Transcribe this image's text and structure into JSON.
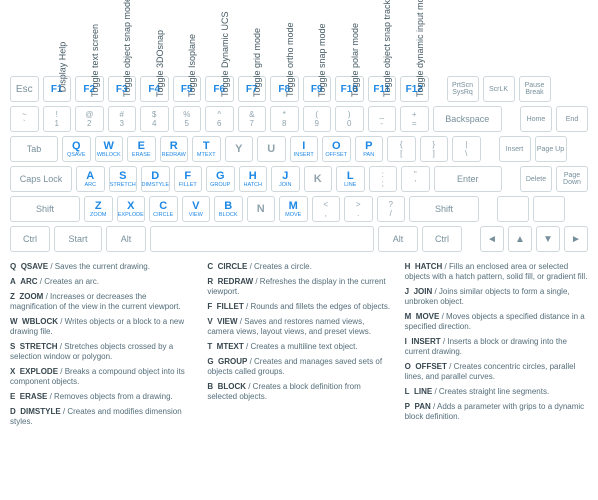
{
  "function_labels": [
    "Display Help",
    "Toggle text screen",
    "Toggle object snap mode",
    "Toggle 3DOsnap",
    "Toggle Isoplane",
    "Toggle Dynamic UCS",
    "Toggle grid mode",
    "Toggle ortho mode",
    "Toggle snap mode",
    "Toggle polar mode",
    "Toggle object snap tracking",
    "Toggle dynamic input mode"
  ],
  "fkeys": [
    "Esc",
    "F1",
    "F2",
    "F3",
    "F4",
    "F5",
    "F6",
    "F7",
    "F8",
    "F9",
    "F10",
    "F11",
    "F12"
  ],
  "side_top": [
    "PrtScn SysRq",
    "ScrLK",
    "Pause Break"
  ],
  "num_row": [
    [
      "~",
      "`"
    ],
    [
      "!",
      "1"
    ],
    [
      "@",
      "2"
    ],
    [
      "#",
      "3"
    ],
    [
      "$",
      "4"
    ],
    [
      "%",
      "5"
    ],
    [
      "^",
      "6"
    ],
    [
      "&",
      "7"
    ],
    [
      "*",
      "8"
    ],
    [
      "(",
      "9"
    ],
    [
      ")",
      "0"
    ],
    [
      "_",
      "-"
    ],
    [
      "+",
      "="
    ]
  ],
  "backspace": "Backspace",
  "side_num": [
    "Home",
    "End"
  ],
  "tab": "Tab",
  "qrow": [
    {
      "c": "Q",
      "cmd": "QSAVE",
      "on": true
    },
    {
      "c": "W",
      "cmd": "WBLOCK",
      "on": true
    },
    {
      "c": "E",
      "cmd": "ERASE",
      "on": true
    },
    {
      "c": "R",
      "cmd": "REDRAW",
      "on": true
    },
    {
      "c": "T",
      "cmd": "MTEXT",
      "on": true
    },
    {
      "c": "Y",
      "cmd": "",
      "on": false
    },
    {
      "c": "U",
      "cmd": "",
      "on": false
    },
    {
      "c": "I",
      "cmd": "INSERT",
      "on": true
    },
    {
      "c": "O",
      "cmd": "OFFSET",
      "on": true
    },
    {
      "c": "P",
      "cmd": "PAN",
      "on": true
    }
  ],
  "brackets": [
    [
      "{",
      "["
    ],
    [
      "}",
      "]"
    ],
    [
      "|",
      "\\"
    ]
  ],
  "side_tab": [
    "Insert",
    "Page Up"
  ],
  "caps": "Caps Lock",
  "arow": [
    {
      "c": "A",
      "cmd": "ARC",
      "on": true
    },
    {
      "c": "S",
      "cmd": "STRETCH",
      "on": true
    },
    {
      "c": "D",
      "cmd": "DIMSTYLE",
      "on": true
    },
    {
      "c": "F",
      "cmd": "FILLET",
      "on": true
    },
    {
      "c": "G",
      "cmd": "GROUP",
      "on": true
    },
    {
      "c": "H",
      "cmd": "HATCH",
      "on": true
    },
    {
      "c": "J",
      "cmd": "JOIN",
      "on": true
    },
    {
      "c": "K",
      "cmd": "",
      "on": false
    },
    {
      "c": "L",
      "cmd": "LINE",
      "on": true
    }
  ],
  "semi": [
    [
      ":",
      ";"
    ],
    [
      "\"",
      "'"
    ]
  ],
  "enter": "Enter",
  "side_caps": [
    "Delete",
    "Page Down"
  ],
  "shift": "Shift",
  "zrow": [
    {
      "c": "Z",
      "cmd": "ZOOM",
      "on": true
    },
    {
      "c": "X",
      "cmd": "EXPLODE",
      "on": true
    },
    {
      "c": "C",
      "cmd": "CIRCLE",
      "on": true
    },
    {
      "c": "V",
      "cmd": "VIEW",
      "on": true
    },
    {
      "c": "B",
      "cmd": "BLOCK",
      "on": true
    },
    {
      "c": "N",
      "cmd": "",
      "on": false
    },
    {
      "c": "M",
      "cmd": "MOVE",
      "on": true
    }
  ],
  "punct": [
    [
      "<",
      ","
    ],
    [
      ">",
      "."
    ],
    [
      "?",
      "/"
    ]
  ],
  "ctrl": "Ctrl",
  "start": "Start",
  "alt": "Alt",
  "arrows": [
    "◄",
    "▲",
    "▼",
    "►"
  ],
  "legend": {
    "col1": [
      {
        "k": "Q",
        "n": "QSAVE",
        "d": "Saves the current drawing."
      },
      {
        "k": "A",
        "n": "ARC",
        "d": "Creates an arc."
      },
      {
        "k": "Z",
        "n": "ZOOM",
        "d": "Increases or decreases the magnification of the view in the current viewport."
      },
      {
        "k": "W",
        "n": "WBLOCK",
        "d": "Writes objects or a block to a new drawing file."
      },
      {
        "k": "S",
        "n": "STRETCH",
        "d": "Stretches objects crossed by a selection window or polygon."
      },
      {
        "k": "X",
        "n": "EXPLODE",
        "d": "Breaks a compound object into its component objects."
      },
      {
        "k": "E",
        "n": "ERASE",
        "d": "Removes objects from a drawing."
      },
      {
        "k": "D",
        "n": "DIMSTYLE",
        "d": "Creates and modifies dimension styles."
      }
    ],
    "col2": [
      {
        "k": "C",
        "n": "CIRCLE",
        "d": "Creates a circle."
      },
      {
        "k": "R",
        "n": "REDRAW",
        "d": "Refreshes the display in the current viewport."
      },
      {
        "k": "F",
        "n": "FILLET",
        "d": "Rounds and fillets the edges of objects."
      },
      {
        "k": "V",
        "n": "VIEW",
        "d": "Saves and restores named views, camera views, layout views, and preset views."
      },
      {
        "k": "T",
        "n": "MTEXT",
        "d": "Creates a multiline text object."
      },
      {
        "k": "G",
        "n": "GROUP",
        "d": "Creates and manages saved sets of objects called groups."
      },
      {
        "k": "B",
        "n": "BLOCK",
        "d": "Creates a block definition from selected objects."
      }
    ],
    "col3": [
      {
        "k": "H",
        "n": "HATCH",
        "d": "Fills an enclosed area or selected objects with a hatch pattern, solid fill, or gradient fill."
      },
      {
        "k": "J",
        "n": "JOIN",
        "d": "Joins similar objects to form a single, unbroken object."
      },
      {
        "k": "M",
        "n": "MOVE",
        "d": "Moves objects a specified distance in a specified direction."
      },
      {
        "k": "I",
        "n": "INSERT",
        "d": "Inserts a block or drawing into the current drawing."
      },
      {
        "k": "O",
        "n": "OFFSET",
        "d": "Creates concentric circles, parallel lines, and parallel curves."
      },
      {
        "k": "L",
        "n": "LINE",
        "d": "Creates straight line segments."
      },
      {
        "k": "P",
        "n": "PAN",
        "d": "Adds a parameter with grips to a dynamic block definition."
      }
    ]
  }
}
